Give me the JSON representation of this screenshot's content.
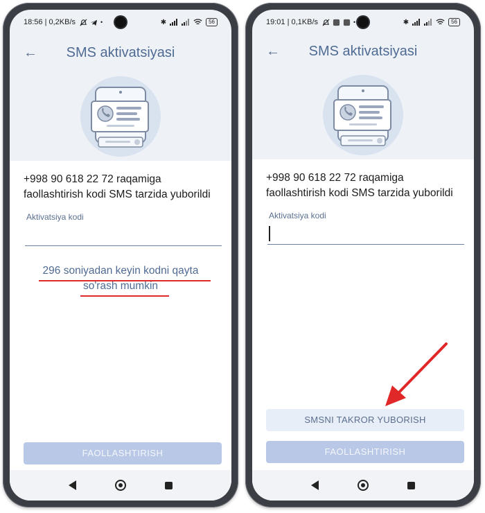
{
  "left": {
    "status_time": "18:56 | 0,2KB/s",
    "battery": "56",
    "title": "SMS aktivatsiyasi",
    "message_line1": "+998 90 618 22 72 raqamiga",
    "message_line2": "faollashtirish kodi SMS tarzida yuborildi",
    "field_label": "Aktivatsiya kodi",
    "countdown_line1": "296 soniyadan keyin kodni qayta",
    "countdown_line2": "so'rash mumkin",
    "activate_button": "FAOLLASHTIRISH"
  },
  "right": {
    "status_time": "19:01 | 0,1KB/s",
    "battery": "56",
    "title": "SMS aktivatsiyasi",
    "message_line1": "+998 90 618 22 72 raqamiga",
    "message_line2": "faollashtirish kodi SMS tarzida yuborildi",
    "field_label": "Aktivatsiya kodi",
    "resend_button": "SMSNI TAKROR YUBORISH",
    "activate_button": "FAOLLASHTIRISH"
  },
  "colors": {
    "accent": "#4f6b93",
    "button_disabled": "#b9c8e6",
    "annotation_red": "#e02828"
  }
}
